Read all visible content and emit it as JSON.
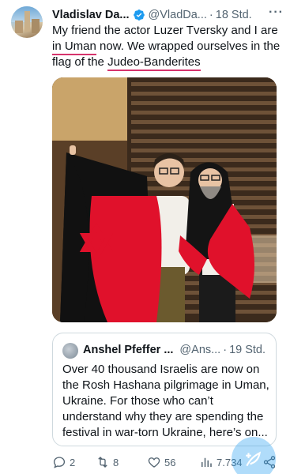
{
  "tweet": {
    "author_name": "Vladislav Da...",
    "handle": "@VladDa...",
    "separator": "·",
    "time": "18 Std.",
    "more": "···",
    "text": {
      "p1": "My friend the actor Luzer Tversky and I are ",
      "u1": "in Uman",
      "p2": " now. We wrapped ourselves in the flag of the ",
      "u2": "Judeo-Banderites"
    }
  },
  "quote": {
    "author_name": "Anshel Pfeffer ...",
    "handle": "@Ans...",
    "separator": "·",
    "time": "19 Std.",
    "text": "Over 40 thousand Israelis are now on the Rosh Hashana pilgrimage in Uman, Ukraine. For those who can’t understand why they are spending the festival in war-torn Ukraine, here’s on..."
  },
  "actions": {
    "replies": "2",
    "retweets": "8",
    "likes": "56",
    "views": "7.734"
  },
  "colors": {
    "verified": "#1d9bf0",
    "underline": "#d6336c",
    "flag_red": "#e0112b",
    "flag_black": "#111111"
  },
  "icons": [
    "verified-badge-icon",
    "more-icon",
    "reply-icon",
    "retweet-icon",
    "like-icon",
    "views-icon",
    "share-icon",
    "compose-icon"
  ]
}
